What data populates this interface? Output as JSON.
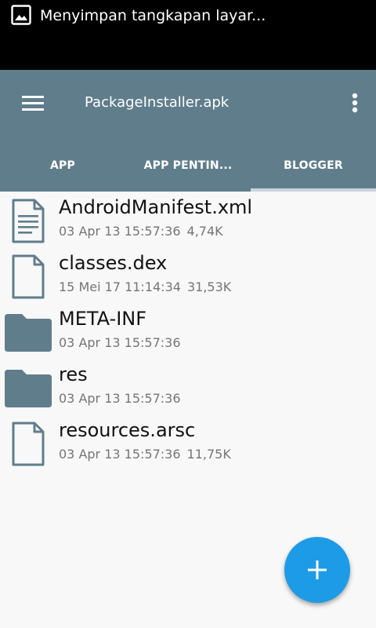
{
  "status_bar": {
    "notification_icon": "image-icon",
    "notification_text": "Menyimpan tangkapan layar..."
  },
  "toolbar": {
    "menu_icon": "hamburger-menu-icon",
    "title": "PackageInstaller.apk",
    "more_icon": "more-vert-icon"
  },
  "tabs": [
    {
      "label": "APP"
    },
    {
      "label": "APP PENTIN..."
    },
    {
      "label": "BLOGGER",
      "selected": true
    }
  ],
  "files": [
    {
      "name": "AndroidManifest.xml",
      "date": "03 Apr 13 15:57:36",
      "size": "4,74K",
      "icon": "text-file-icon"
    },
    {
      "name": "classes.dex",
      "date": "15 Mei 17 11:14:34",
      "size": "31,53K",
      "icon": "file-icon"
    },
    {
      "name": "META-INF",
      "date": "03 Apr 13 15:57:36",
      "size": "",
      "icon": "folder-icon"
    },
    {
      "name": "res",
      "date": "03 Apr 13 15:57:36",
      "size": "",
      "icon": "folder-icon"
    },
    {
      "name": "resources.arsc",
      "date": "03 Apr 13 15:57:36",
      "size": "11,75K",
      "icon": "file-icon"
    }
  ],
  "fab": {
    "icon": "plus-icon"
  },
  "colors": {
    "appbar": "#607d8b",
    "fab": "#1e9be6",
    "icon": "#607d8b",
    "background": "#f8f8f8"
  }
}
